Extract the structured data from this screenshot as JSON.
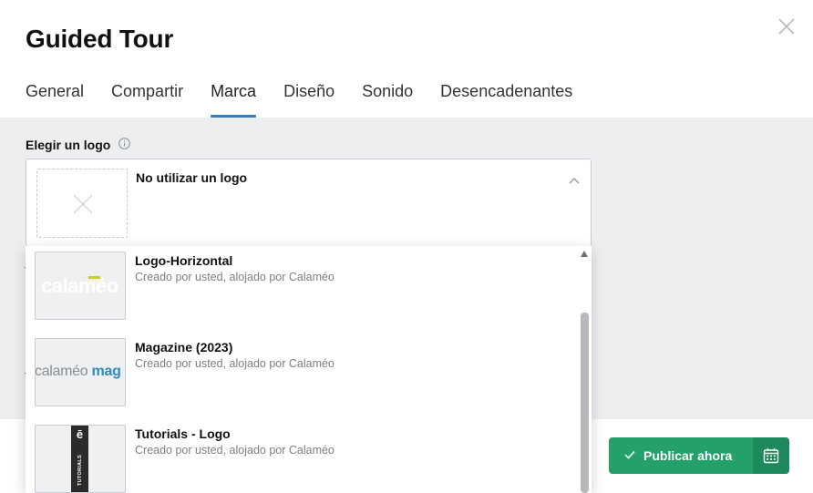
{
  "dialog": {
    "title": "Guided Tour",
    "close_icon": "close-icon"
  },
  "tabs": [
    {
      "label": "General",
      "active": false
    },
    {
      "label": "Compartir",
      "active": false
    },
    {
      "label": "Marca",
      "active": true
    },
    {
      "label": "Diseño",
      "active": false
    },
    {
      "label": "Sonido",
      "active": false
    },
    {
      "label": "Desencadenantes",
      "active": false
    }
  ],
  "logo_field": {
    "label": "Elegir un logo",
    "info_icon": "info-icon",
    "selected_value": "No utilizar un logo",
    "chevron_icon": "chevron-up-icon",
    "options": [
      {
        "name": "Logo-Horizontal",
        "subtitle": "Creado por usted, alojado por Calaméo",
        "thumb_text": "calaméo"
      },
      {
        "name": "Magazine (2023)",
        "subtitle": "Creado por usted, alojado por Calaméo",
        "thumb_text": "calaméo",
        "thumb_text_accent": "mag"
      },
      {
        "name": "Tutorials - Logo",
        "subtitle": "Creado por usted, alojado por Calaméo",
        "thumb_text": "ē",
        "thumb_text_vertical": "TUTORIALS"
      }
    ]
  },
  "footer": {
    "publish_label": "Publicar ahora",
    "schedule_icon": "calendar-icon"
  },
  "colors": {
    "accent_tab": "#2f80c5",
    "publish_green": "#24a06b",
    "publish_green_dark": "#1e8a5b",
    "body_gray": "#edeef0"
  }
}
